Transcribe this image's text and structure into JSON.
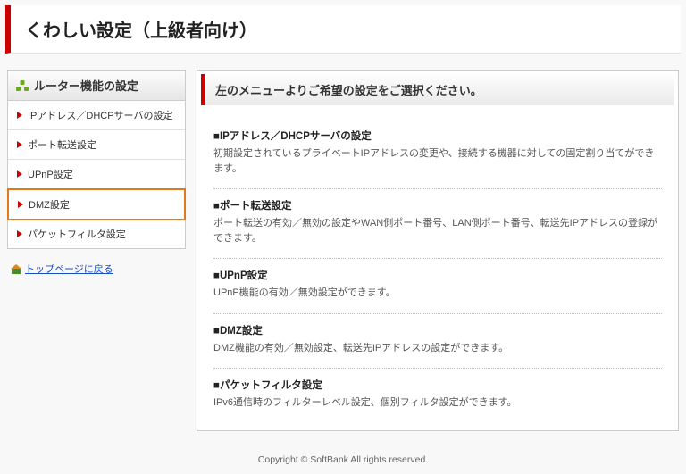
{
  "header": {
    "title": "くわしい設定（上級者向け）"
  },
  "sidebar": {
    "title": "ルーター機能の設定",
    "items": [
      {
        "label": "IPアドレス／DHCPサーバの設定"
      },
      {
        "label": "ポート転送設定"
      },
      {
        "label": "UPnP設定"
      },
      {
        "label": "DMZ設定"
      },
      {
        "label": "パケットフィルタ設定"
      }
    ],
    "toplink": "トップページに戻る"
  },
  "main": {
    "heading": "左のメニューよりご希望の設定をご選択ください。",
    "sections": [
      {
        "title": "■IPアドレス／DHCPサーバの設定",
        "desc": "初期設定されているプライベートIPアドレスの変更や、接続する機器に対しての固定割り当てができます。"
      },
      {
        "title": "■ポート転送設定",
        "desc": "ポート転送の有効／無効の設定やWAN側ポート番号、LAN側ポート番号、転送先IPアドレスの登録ができます。"
      },
      {
        "title": "■UPnP設定",
        "desc": "UPnP機能の有効／無効設定ができます。"
      },
      {
        "title": "■DMZ設定",
        "desc": "DMZ機能の有効／無効設定、転送先IPアドレスの設定ができます。"
      },
      {
        "title": "■パケットフィルタ設定",
        "desc": "IPv6通信時のフィルターレベル設定、個別フィルタ設定ができます。"
      }
    ]
  },
  "footer": {
    "copyright": "Copyright © SoftBank All rights reserved."
  }
}
